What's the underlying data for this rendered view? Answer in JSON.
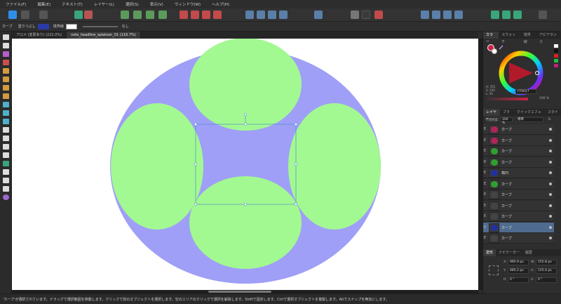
{
  "menu": [
    "ファイル(F)",
    "編集(E)",
    "テキスト(T)",
    "レイヤー(L)",
    "選択(S)",
    "表示(V)",
    "ウィンドウ(W)",
    "ヘルプ(H)"
  ],
  "context": {
    "tool_label": "カーブ",
    "fill_label": "塗りつぶし",
    "stroke_label": "境界線",
    "none_label": "なし"
  },
  "doc_tabs": [
    {
      "label": "アロメ (変更あり) (221.0%)",
      "active": false
    },
    {
      "label": "note_headline_splatoon_01 (116.7%)",
      "active": true
    }
  ],
  "color_panel": {
    "tabs": [
      "カラー",
      "スウォッチ",
      "境界線",
      "アピアランス"
    ],
    "hsl": [
      "H: 355",
      "S: 100",
      "L: 50"
    ],
    "hex": "FF0017",
    "opacity": "100 %"
  },
  "layers_panel": {
    "tabs": [
      "レイヤー",
      "ブラシ",
      "クイックエフェクト",
      "スタイル"
    ],
    "opacity_label": "不透明度:",
    "opacity_value": "100 %",
    "blend_mode": "標準",
    "layers": [
      {
        "name": "カーブ",
        "selected": false
      },
      {
        "name": "カーブ",
        "selected": false
      },
      {
        "name": "カーブ",
        "selected": false
      },
      {
        "name": "カーブ",
        "selected": false
      },
      {
        "name": "楕円",
        "selected": false
      },
      {
        "name": "カーブ",
        "selected": false
      },
      {
        "name": "カーブ",
        "selected": false
      },
      {
        "name": "カーブ",
        "selected": false
      },
      {
        "name": "カーブ",
        "selected": false
      },
      {
        "name": "カーブ",
        "selected": true
      },
      {
        "name": "カーブ",
        "selected": false
      }
    ]
  },
  "transform_panel": {
    "tabs": [
      "変形",
      "ナビゲーター",
      "履歴"
    ],
    "x": "995.9 px",
    "y": "485.2 px",
    "w": "155.8 px",
    "h": "125.4 px",
    "r": "0 °",
    "s": "0 °",
    "labels": {
      "x": "X:",
      "y": "Y:",
      "w": "W:",
      "h": "H:",
      "r": "R:",
      "s": "S:"
    }
  },
  "colors": {
    "ellipse": "#9f9ff7",
    "circles": "#a3f991",
    "accent": "#4f6b8f"
  },
  "status": "'カーブ'が選択されています。ドラッグで選択範囲を移動します。クリックで別のオブジェクトを選択します。空のエリアのクリックで選択を解除します。Shiftで固定します。Ctrlで選択オブジェクトを複製します。Altでスナップを無効にします。"
}
